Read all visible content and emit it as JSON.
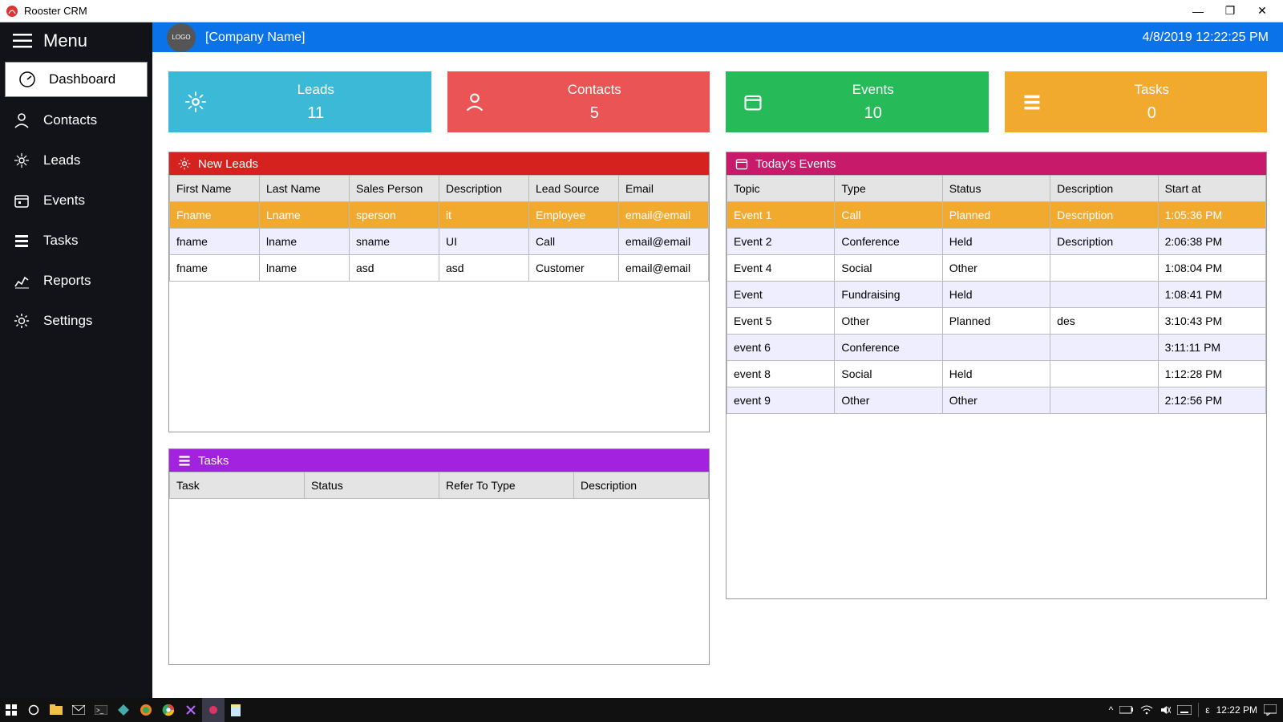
{
  "window": {
    "title": "Rooster CRM",
    "company_name": "[Company Name]",
    "logo_text": "LOGO",
    "datetime": "4/8/2019 12:22:25 PM"
  },
  "menu": {
    "header": "Menu",
    "items": [
      {
        "label": "Dashboard"
      },
      {
        "label": "Contacts"
      },
      {
        "label": "Leads"
      },
      {
        "label": "Events"
      },
      {
        "label": "Tasks"
      },
      {
        "label": "Reports"
      },
      {
        "label": "Settings"
      }
    ]
  },
  "cards": {
    "leads": {
      "label": "Leads",
      "value": "11"
    },
    "contacts": {
      "label": "Contacts",
      "value": "5"
    },
    "events": {
      "label": "Events",
      "value": "10"
    },
    "tasks": {
      "label": "Tasks",
      "value": "0"
    }
  },
  "newLeads": {
    "title": "New Leads",
    "columns": [
      "First Name",
      "Last Name",
      "Sales Person",
      "Description",
      "Lead Source",
      "Email"
    ],
    "rows": [
      [
        "Fname",
        "Lname",
        "sperson",
        "it",
        "Employee",
        "email@email"
      ],
      [
        "fname",
        "lname",
        "sname",
        "UI",
        "Call",
        "email@email"
      ],
      [
        "fname",
        "lname",
        "asd",
        "asd",
        "Customer",
        "email@email"
      ]
    ]
  },
  "tasksPanel": {
    "title": "Tasks",
    "columns": [
      "Task",
      "Status",
      "Refer To Type",
      "Description"
    ],
    "rows": []
  },
  "eventsPanel": {
    "title": "Today's Events",
    "columns": [
      "Topic",
      "Type",
      "Status",
      "Description",
      "Start at"
    ],
    "rows": [
      [
        "Event 1",
        "Call",
        "Planned",
        "Description",
        "1:05:36 PM"
      ],
      [
        "Event 2",
        "Conference",
        "Held",
        "Description",
        "2:06:38 PM"
      ],
      [
        "Event 4",
        "Social",
        "Other",
        "",
        "1:08:04 PM"
      ],
      [
        "Event",
        "Fundraising",
        "Held",
        "",
        "1:08:41 PM"
      ],
      [
        "Event 5",
        "Other",
        "Planned",
        "des",
        "3:10:43 PM"
      ],
      [
        "event 6",
        "Conference",
        "",
        "",
        "3:11:11 PM"
      ],
      [
        "event 8",
        "Social",
        "Held",
        "",
        "1:12:28 PM"
      ],
      [
        "event 9",
        "Other",
        "Other",
        "",
        "2:12:56 PM"
      ]
    ]
  },
  "taskbar": {
    "lang": "ε",
    "clock": "12:22 PM"
  }
}
